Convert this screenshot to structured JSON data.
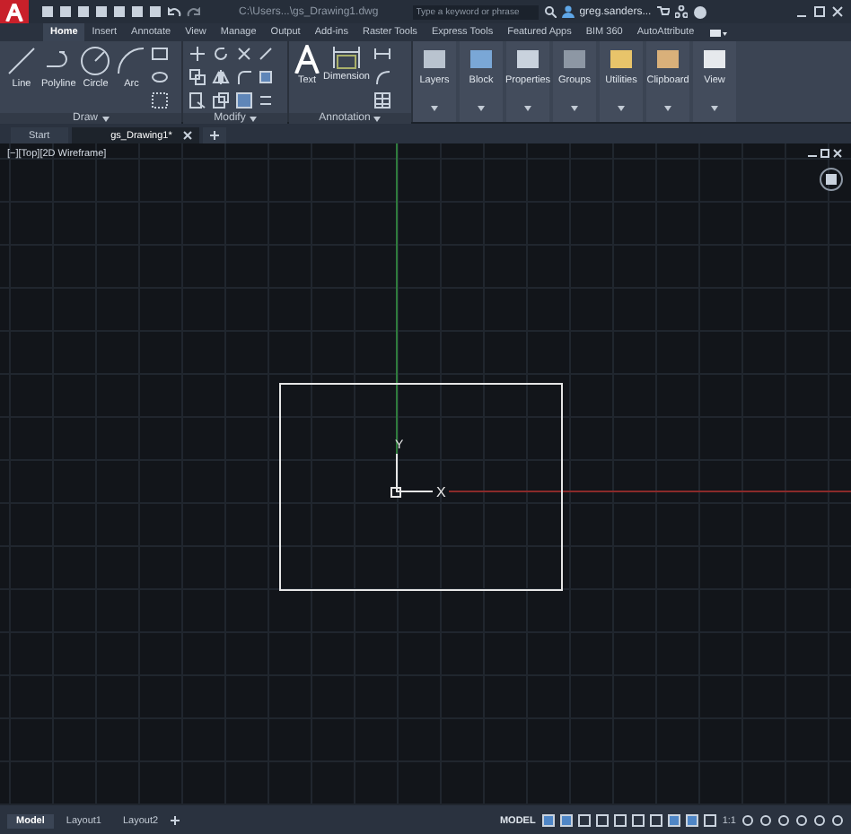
{
  "title_bar": {
    "title": "C:\\Users...\\gs_Drawing1.dwg",
    "search": {
      "placeholder": "Type a keyword or phrase"
    },
    "user": "greg.sanders..."
  },
  "ribbon_tabs": [
    {
      "label": "Home",
      "selected": true
    },
    {
      "label": "Insert",
      "selected": false
    },
    {
      "label": "Annotate",
      "selected": false
    },
    {
      "label": "View",
      "selected": false
    },
    {
      "label": "Manage",
      "selected": false
    },
    {
      "label": "Output",
      "selected": false
    },
    {
      "label": "Add-ins",
      "selected": false
    },
    {
      "label": "Raster Tools",
      "selected": false
    },
    {
      "label": "Express Tools",
      "selected": false
    },
    {
      "label": "Featured Apps",
      "selected": false
    },
    {
      "label": "BIM 360",
      "selected": false
    },
    {
      "label": "AutoAttribute",
      "selected": false
    }
  ],
  "panels": [
    {
      "title": "Draw",
      "tools": [
        "Line",
        "Polyline",
        "Circle",
        "Arc"
      ]
    },
    {
      "title": "Modify"
    },
    {
      "title": "Annotation",
      "tools": [
        "Text",
        "Dimension"
      ]
    }
  ],
  "big_tools": [
    "Layers",
    "Block",
    "Properties",
    "Groups",
    "Utilities",
    "Clipboard",
    "View"
  ],
  "file_tabs": [
    {
      "label": "Start",
      "selected": false
    },
    {
      "label": "gs_Drawing1*",
      "selected": true
    }
  ],
  "viewport": {
    "label": "[−][Top][2D Wireframe]",
    "y_axis": "Y",
    "x_axis": "X"
  },
  "layout_tabs": [
    {
      "label": "Model",
      "selected": true
    },
    {
      "label": "Layout1",
      "selected": false
    },
    {
      "label": "Layout2",
      "selected": false
    }
  ],
  "status_bar": {
    "mode": "MODEL",
    "scale": "1:1"
  }
}
